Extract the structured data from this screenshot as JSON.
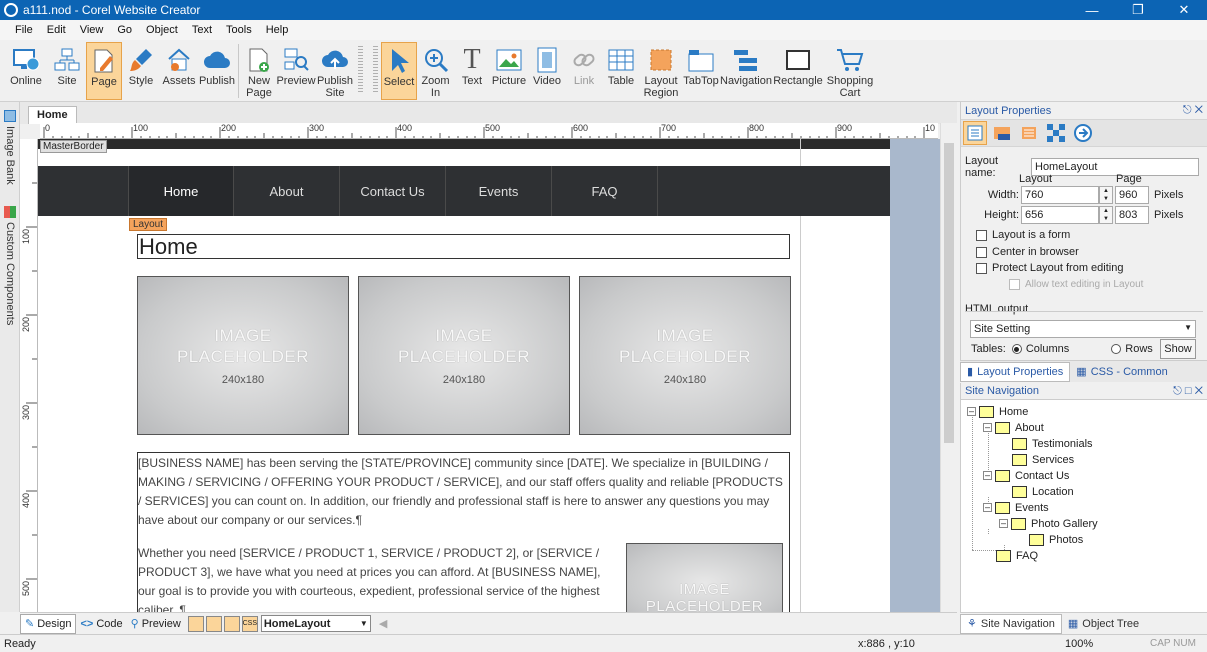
{
  "window": {
    "title": "a111.nod - Corel Website Creator"
  },
  "menu": [
    "File",
    "Edit",
    "View",
    "Go",
    "Object",
    "Text",
    "Tools",
    "Help"
  ],
  "toolbar": {
    "group1": [
      {
        "label": "Online"
      },
      {
        "label": "Site"
      },
      {
        "label": "Page"
      },
      {
        "label": "Style"
      },
      {
        "label": "Assets"
      },
      {
        "label": "Publish"
      }
    ],
    "group2": [
      {
        "label": "New\nPage"
      },
      {
        "label": "Preview"
      },
      {
        "label": "Publish\nSite"
      }
    ],
    "group3": [
      {
        "label": "Select"
      },
      {
        "label": "Zoom\nIn"
      },
      {
        "label": "Text"
      },
      {
        "label": "Picture"
      },
      {
        "label": "Video"
      },
      {
        "label": "Link"
      },
      {
        "label": "Table"
      },
      {
        "label": "Layout\nRegion"
      },
      {
        "label": "TabTop"
      },
      {
        "label": "Navigation"
      },
      {
        "label": "Rectangle"
      },
      {
        "label": "Shopping\nCart"
      }
    ]
  },
  "left_tabs": {
    "image_bank": "Image Bank",
    "custom_components": "Custom Components"
  },
  "doc_tab": "Home",
  "ruler": {
    "h_labels": [
      "0",
      "100",
      "200",
      "300",
      "400",
      "500",
      "600",
      "700",
      "800",
      "900",
      "10"
    ],
    "v_labels": [
      "100",
      "200",
      "300",
      "400",
      "500"
    ]
  },
  "canvas": {
    "masterborder_tag": "MasterBorder",
    "layout_tag": "Layout",
    "nav": [
      "Home",
      "About",
      "Contact Us",
      "Events",
      "FAQ"
    ],
    "page_title": "Home",
    "placeholder": {
      "line1": "IMAGE",
      "line2": "PLACEHOLDER",
      "size": "240x180"
    },
    "para1": "[BUSINESS NAME] has been serving the [STATE/PROVINCE] community since [DATE]. We specialize in [BUILDING / MAKING / SERVICING / OFFERING YOUR PRODUCT / SERVICE], and our staff offers quality and reliable [PRODUCTS / SERVICES] you can count on. In addition, our friendly and professional staff is here to answer any questions you may have about our company or our services.¶",
    "para2": "Whether you need [SERVICE / PRODUCT 1, SERVICE / PRODUCT 2], or [SERVICE / PRODUCT 3], we have what you need at prices you can afford. At [BUSINESS NAME], our goal is to provide you with courteous, expedient, professional service of the highest caliber. ¶"
  },
  "bottom_tabs": {
    "design": "Design",
    "code": "Code",
    "preview": "Preview",
    "layout_select": "HomeLayout"
  },
  "status": {
    "ready": "Ready",
    "coords": "x:886 , y:10",
    "zoom": "100%",
    "caps": "CAP NUM"
  },
  "layout_props": {
    "title": "Layout Properties",
    "name_label": "Layout name:",
    "name_value": "HomeLayout",
    "col_layout": "Layout",
    "col_page": "Page",
    "width_label": "Width:",
    "width_value": "760",
    "width_page": "960",
    "height_label": "Height:",
    "height_value": "656",
    "height_page": "803",
    "pixels": "Pixels",
    "chk_form": "Layout is a form",
    "chk_center": "Center in browser",
    "chk_protect": "Protect Layout from editing",
    "chk_allow": "Allow text editing in Layout",
    "html_output": "HTML output",
    "site_setting": "Site Setting",
    "tables_label": "Tables:",
    "columns": "Columns",
    "rows": "Rows",
    "show": "Show"
  },
  "panel_tabs": {
    "layout_properties": "Layout Properties",
    "css_common": "CSS - Common"
  },
  "site_nav": {
    "title": "Site Navigation",
    "nodes": [
      "Home",
      "About",
      "Testimonials",
      "Services",
      "Contact Us",
      "Location",
      "Events",
      "Photo Gallery",
      "Photos",
      "FAQ"
    ]
  },
  "nav_tabs": {
    "site_navigation": "Site Navigation",
    "object_tree": "Object Tree"
  },
  "colors": {
    "titlebar": "#0c64b4",
    "active_tool": "#fbd59a",
    "navbar": "#2e3033",
    "layout_tag": "#f4a35c"
  }
}
